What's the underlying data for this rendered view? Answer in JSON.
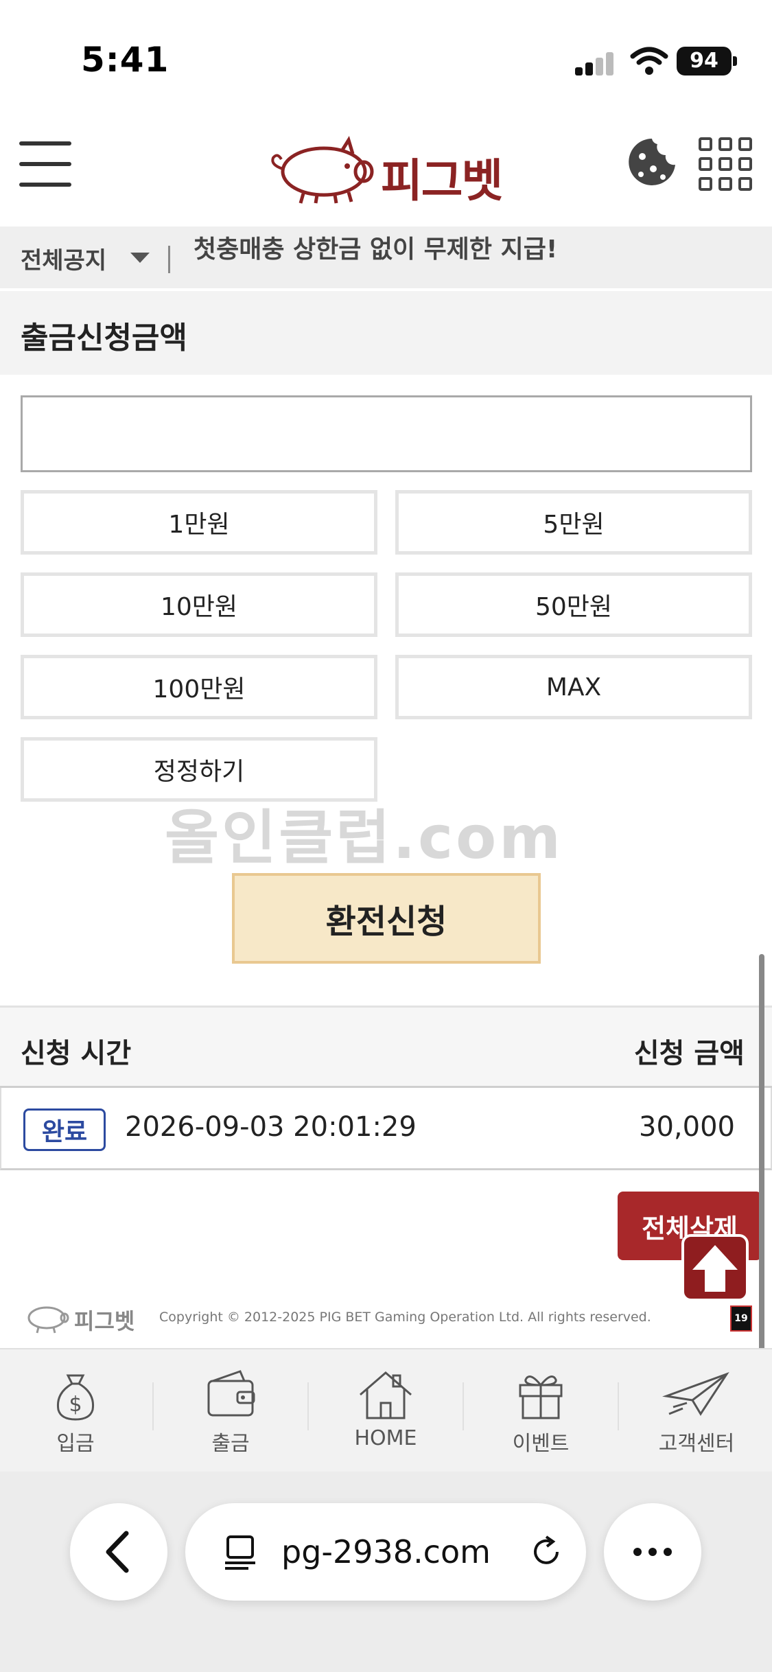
{
  "status_bar": {
    "time": "5:41",
    "battery": "94"
  },
  "header": {
    "logo_text": "피그벳"
  },
  "notice": {
    "label": "전체공지",
    "text": "첫충매충 상한금 없이 무제한 지급!"
  },
  "withdraw": {
    "title": "출금신청금액",
    "amount_value": "",
    "buttons": [
      "1만원",
      "5만원",
      "10만원",
      "50만원",
      "100만원",
      "MAX",
      "정정하기"
    ],
    "submit_label": "환전신청"
  },
  "watermark": "올인클럽.com",
  "history": {
    "col_time": "신청 시간",
    "col_amount": "신청 금액",
    "rows": [
      {
        "status": "완료",
        "time": "2026-09-03 20:01:29",
        "amount": "30,000"
      }
    ],
    "delete_all_label": "전체삭제"
  },
  "footer": {
    "logo_text": "피그벳",
    "copyright": "Copyright © 2012-2025 PIG BET Gaming Operation Ltd. All rights reserved.",
    "age_badge": "19"
  },
  "bottom_nav": [
    {
      "label": "입금",
      "icon": "money-bag-icon"
    },
    {
      "label": "출금",
      "icon": "wallet-icon"
    },
    {
      "label": "HOME",
      "icon": "house-icon"
    },
    {
      "label": "이벤트",
      "icon": "gift-icon"
    },
    {
      "label": "고객센터",
      "icon": "paper-plane-icon"
    }
  ],
  "browser": {
    "url": "pg-2938.com"
  },
  "colors": {
    "brand": "#8b2323",
    "accent_button": "#f7e8c8",
    "delete_button": "#a8282a",
    "status_badge": "#2c4aa0"
  }
}
